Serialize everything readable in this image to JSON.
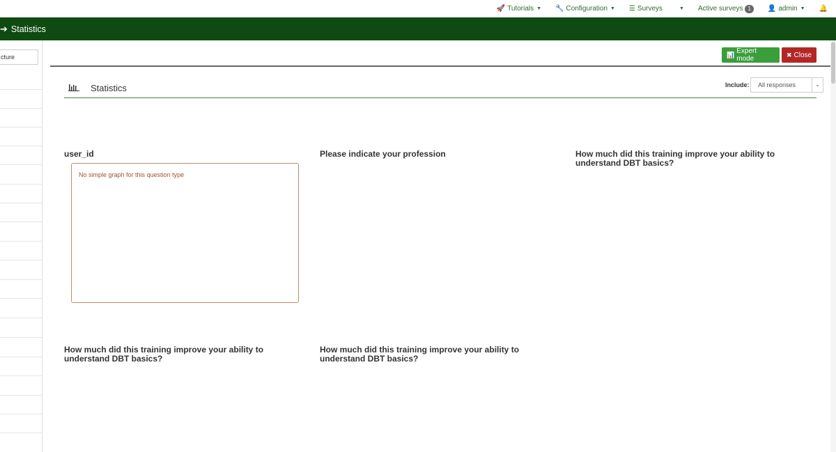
{
  "topnav": {
    "tutorials": "Tutorials",
    "configuration": "Configuration",
    "surveys": "Surveys",
    "active_surveys": "Active surveys",
    "active_count": "1",
    "user": "admin"
  },
  "breadcrumb": {
    "label": "Statistics"
  },
  "sidebar": {
    "search_value": "cture"
  },
  "toolbar": {
    "expert_mode": "Expert mode",
    "close": "Close"
  },
  "section": {
    "title": "Statistics",
    "include_label": "Include:",
    "include_value": "All responses"
  },
  "questions": [
    {
      "title": "user_id",
      "message": "No simple graph for this question type"
    },
    {
      "title": "Please indicate your profession"
    },
    {
      "title": "How much did this training improve your ability to understand DBT basics?"
    },
    {
      "title": "How much did this training improve your ability to understand DBT basics?"
    },
    {
      "title": "How much did this training improve your ability to understand DBT basics?"
    }
  ],
  "colors": {
    "brand_dark": "#0f4a12",
    "success": "#3a9e3a",
    "danger": "#b32727",
    "link": "#2e6b2e"
  }
}
